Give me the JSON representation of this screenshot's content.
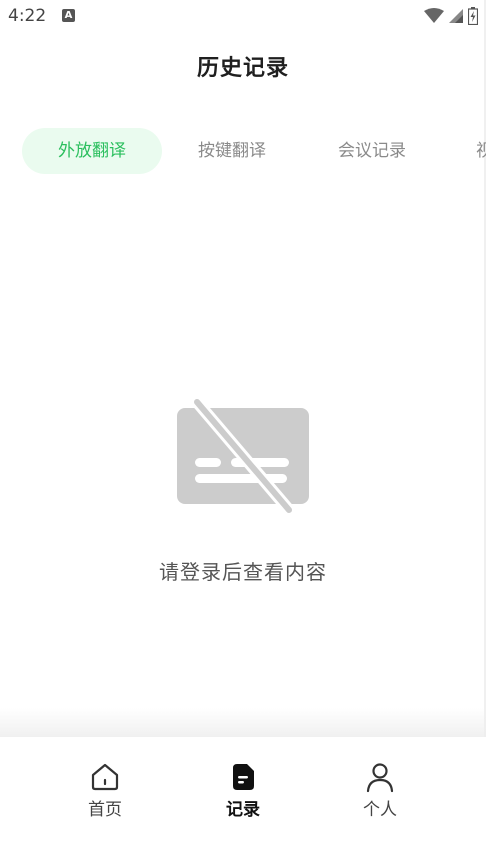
{
  "status_bar": {
    "time": "4:22",
    "notification_icon": "A"
  },
  "page": {
    "title": "历史记录"
  },
  "tabs": [
    {
      "label": "外放翻译",
      "active": true
    },
    {
      "label": "按键翻译",
      "active": false
    },
    {
      "label": "会议记录",
      "active": false
    },
    {
      "label": "视",
      "active": false
    }
  ],
  "empty_state": {
    "icon": "no-content-icon",
    "message": "请登录后查看内容"
  },
  "bottom_nav": {
    "items": [
      {
        "label": "首页",
        "icon": "home-icon",
        "active": false
      },
      {
        "label": "记录",
        "icon": "record-icon",
        "active": true
      },
      {
        "label": "个人",
        "icon": "person-icon",
        "active": false
      }
    ]
  },
  "colors": {
    "accent": "#2bbf5e",
    "tab_active_bg": "#eafbef",
    "inactive_text": "#8a8a8a",
    "empty_icon": "#cccccc"
  }
}
